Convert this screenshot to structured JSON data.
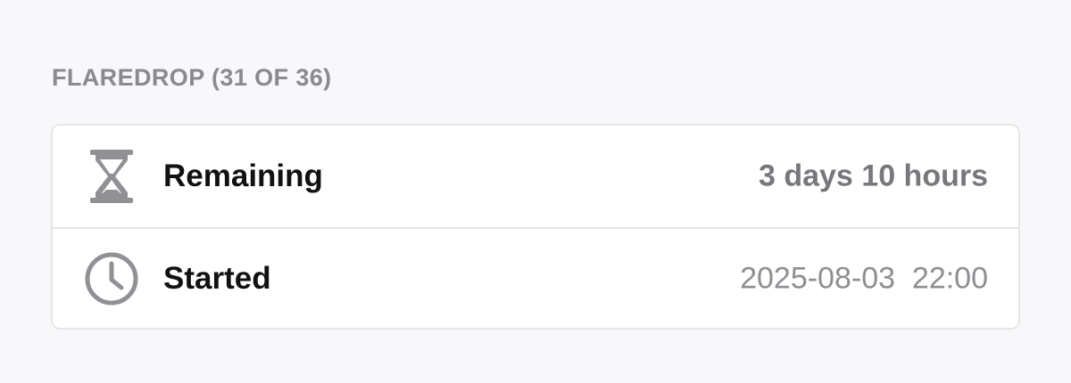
{
  "section": {
    "title": "FLAREDROP (31 OF 36)"
  },
  "rows": [
    {
      "label": "Remaining",
      "value": "3 days 10 hours",
      "icon": "hourglass-icon"
    },
    {
      "label": "Started",
      "value": "2025-08-03  22:00",
      "icon": "clock-icon"
    }
  ],
  "colors": {
    "background": "#f8f8fa",
    "card": "#ffffff",
    "border": "#e6e6e8",
    "icon": "#909095",
    "label": "#111114",
    "value": "#8e8e93"
  }
}
